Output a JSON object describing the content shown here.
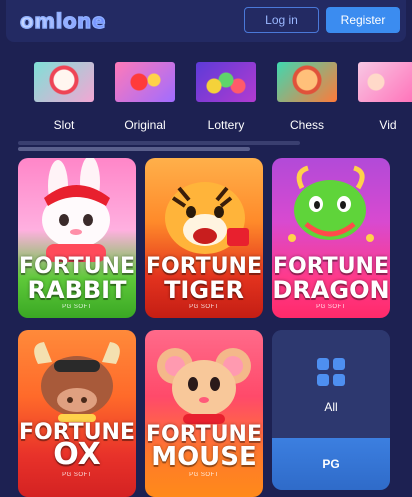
{
  "header": {
    "logo_text": "omlone",
    "login_label": "Log in",
    "register_label": "Register"
  },
  "categories": [
    {
      "label": "Slot"
    },
    {
      "label": "Original"
    },
    {
      "label": "Lottery"
    },
    {
      "label": "Chess"
    },
    {
      "label": "Vid"
    }
  ],
  "games": [
    {
      "line1": "FORTUNE",
      "line2": "RABBIT",
      "provider": "PG SOFT"
    },
    {
      "line1": "FORTUNE",
      "line2": "TIGER",
      "provider": "PG SOFT"
    },
    {
      "line1": "FORTUNE",
      "line2": "DRAGON",
      "provider": "PG SOFT"
    },
    {
      "line1": "FORTUNE",
      "line2": "OX",
      "provider": "PG SOFT"
    },
    {
      "line1": "FORTUNE",
      "line2": "MOUSE",
      "provider": "PG SOFT"
    }
  ],
  "panel": {
    "all_label": "All",
    "pg_label": "PG"
  },
  "icons": {
    "grid": "grid-icon"
  },
  "colors": {
    "background": "#1d2152",
    "header": "#232a63",
    "accent": "#3b8cf0",
    "login_border": "#4a78d8"
  }
}
